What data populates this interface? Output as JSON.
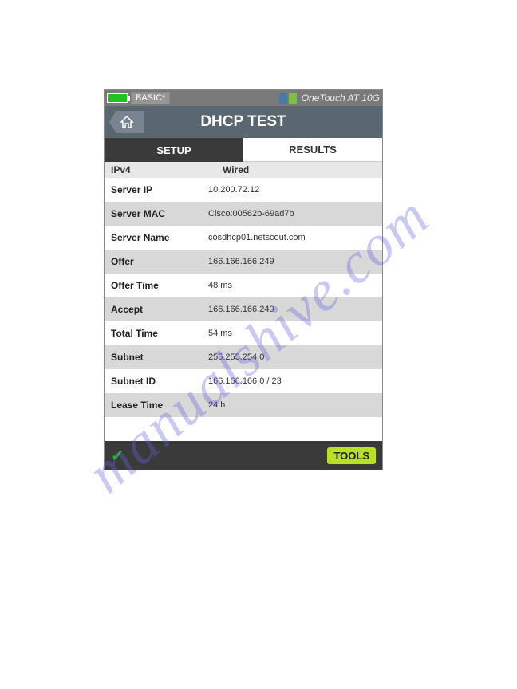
{
  "status": {
    "mode": "BASIC*",
    "product_name": "OneTouch AT 10G"
  },
  "title": "DHCP TEST",
  "tabs": {
    "setup": "SETUP",
    "results": "RESULTS"
  },
  "header": {
    "col1": "IPv4",
    "col2": "Wired"
  },
  "rows": [
    {
      "label": "Server IP",
      "value": "10.200.72.12",
      "shade": "light"
    },
    {
      "label": "Server MAC",
      "value": "Cisco:00562b-69ad7b",
      "shade": "dark"
    },
    {
      "label": "Server Name",
      "value": "cosdhcp01.netscout.com",
      "shade": "light"
    },
    {
      "label": "Offer",
      "value": "166.166.166.249",
      "shade": "dark"
    },
    {
      "label": "Offer Time",
      "value": "48 ms",
      "shade": "light"
    },
    {
      "label": "Accept",
      "value": "166.166.166.249",
      "shade": "dark"
    },
    {
      "label": "Total Time",
      "value": "54 ms",
      "shade": "light"
    },
    {
      "label": "Subnet",
      "value": "255.255.254.0",
      "shade": "dark"
    },
    {
      "label": "Subnet ID",
      "value": "166.166.166.0 / 23",
      "shade": "light"
    },
    {
      "label": "Lease Time",
      "value": "24 h",
      "shade": "dark"
    },
    {
      "label": "",
      "value": "",
      "shade": "light"
    }
  ],
  "bottom": {
    "tools": "TOOLS"
  },
  "watermark": "manualshive.com"
}
